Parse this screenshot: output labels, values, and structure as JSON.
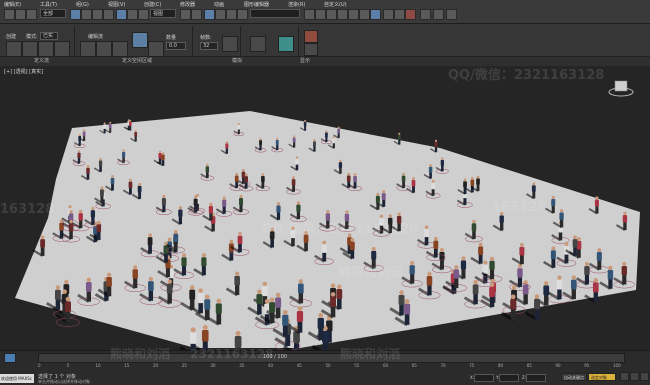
{
  "menu": {
    "items": [
      "编辑(E)",
      "工具(T)",
      "组(G)",
      "视图(V)",
      "创建(C)",
      "修改器",
      "动画",
      "图形编辑器",
      "渲染(R)",
      "自定义(U)",
      "MAXScript(M)",
      "帮助(H)"
    ]
  },
  "toolbar": {
    "selection_filter": "全部",
    "view_dropdown": "视图"
  },
  "ribbon": {
    "label_create": "创建",
    "label_mode": "模式:",
    "mode_value": "已实",
    "label_flow": "流",
    "label_edit_flow": "编辑流",
    "label_count": "数量",
    "count_value": "0.0",
    "label_sim": "模拟",
    "label_anim": "渲染",
    "label_config": "显示",
    "label_frame": "帧数:",
    "frame_value": "32",
    "label_time": "播放当前值:",
    "group1": "定义流",
    "group2": "定义空闲区域",
    "group3": "模拟",
    "group4": "显示"
  },
  "viewport": {
    "label": "[+] [透视] [真实]"
  },
  "watermarks": [
    "QQ/微信：2321163128",
    "QQ/微信：2321163128",
    "熊晓和刘滔",
    "2321163128",
    "163128",
    "熊晓和刘滔",
    "QQ/微信：2321163128",
    "熊晓和刘滔"
  ],
  "timeline": {
    "frame": "100 / 100",
    "ticks": [
      "0",
      "5",
      "10",
      "15",
      "20",
      "25",
      "30",
      "35",
      "40",
      "45",
      "50",
      "55",
      "60",
      "65",
      "70",
      "75",
      "80",
      "85",
      "90",
      "95",
      "100"
    ]
  },
  "status": {
    "script_label": "欢迎使用 MAXSc",
    "selection": "选择了 1 个 对象",
    "hint": "单击并拖动以选择并移动对象",
    "x_label": "X:",
    "y_label": "Y:",
    "z_label": "Z:",
    "grid": "栅格 = 10.0",
    "auto_key": "自动关键点",
    "selected": "选定对象",
    "set_key": "设置关键点",
    "key_filter": "关键点过滤器..."
  },
  "colors": {
    "floor": "#cfcfcf",
    "background": "#252525",
    "accent_blue": "#4a7eb0",
    "key_yellow": "#d8b03a"
  }
}
